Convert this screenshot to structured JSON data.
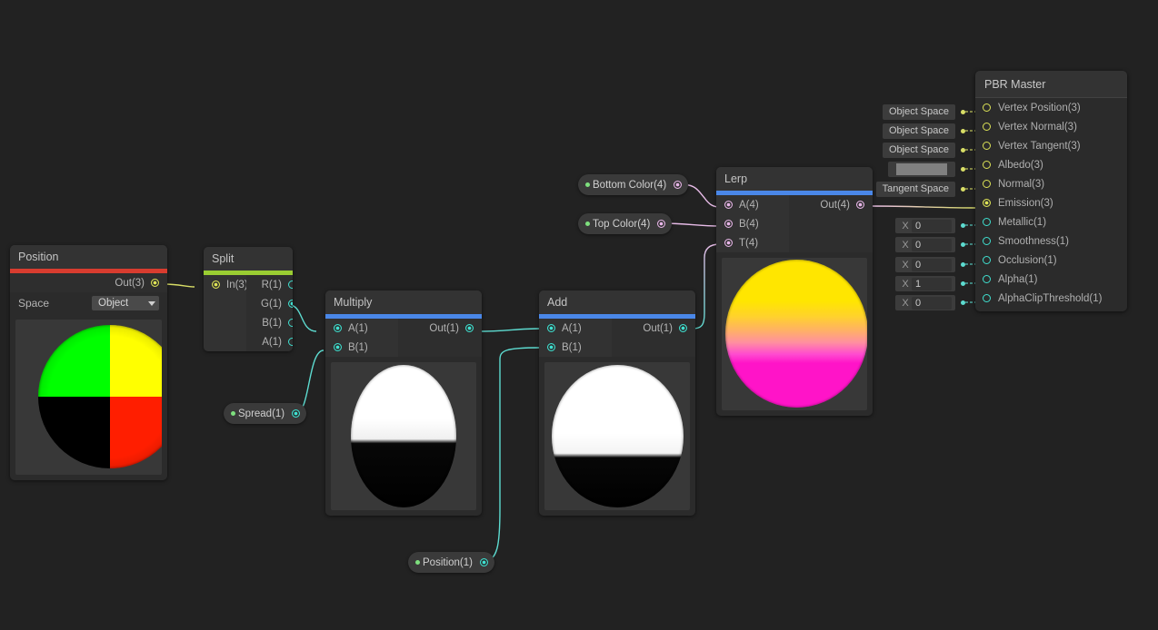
{
  "graph": {
    "background_color": "#222222",
    "node_color": "#2b2b2b",
    "accent_colors": {
      "position": "#d83c2f",
      "split": "#9acd32",
      "math": "#4a87e8"
    },
    "wire_colors": {
      "vector3": "#d8dd66",
      "float": "#5ddbd0",
      "vector4": "#e8bce8"
    }
  },
  "nodes": {
    "position": {
      "title": "Position",
      "accent": "#d83c2f",
      "outputs": [
        {
          "label": "Out(3)",
          "type": "vector3",
          "connected": true
        }
      ],
      "property": {
        "label": "Space",
        "value": "Object"
      },
      "preview": "position-object-space"
    },
    "split": {
      "title": "Split",
      "accent": "#9acd32",
      "inputs": [
        {
          "label": "In(3)",
          "type": "vector3",
          "connected": true
        }
      ],
      "outputs": [
        {
          "label": "R(1)",
          "type": "float",
          "connected": false
        },
        {
          "label": "G(1)",
          "type": "float",
          "connected": true
        },
        {
          "label": "B(1)",
          "type": "float",
          "connected": false
        },
        {
          "label": "A(1)",
          "type": "float",
          "connected": false
        }
      ]
    },
    "multiply": {
      "title": "Multiply",
      "accent": "#4a87e8",
      "inputs": [
        {
          "label": "A(1)",
          "type": "float",
          "connected": true
        },
        {
          "label": "B(1)",
          "type": "float",
          "connected": true
        }
      ],
      "outputs": [
        {
          "label": "Out(1)",
          "type": "float",
          "connected": true
        }
      ],
      "preview": "half-white-gradient"
    },
    "add": {
      "title": "Add",
      "accent": "#4a87e8",
      "inputs": [
        {
          "label": "A(1)",
          "type": "float",
          "connected": true
        },
        {
          "label": "B(1)",
          "type": "float",
          "connected": true
        }
      ],
      "outputs": [
        {
          "label": "Out(1)",
          "type": "float",
          "connected": true
        }
      ],
      "preview": "half-white-gradient-wide"
    },
    "lerp": {
      "title": "Lerp",
      "accent": "#4a87e8",
      "inputs": [
        {
          "label": "A(4)",
          "type": "vector4",
          "connected": true
        },
        {
          "label": "B(4)",
          "type": "vector4",
          "connected": true
        },
        {
          "label": "T(4)",
          "type": "vector4",
          "connected": true
        }
      ],
      "outputs": [
        {
          "label": "Out(4)",
          "type": "vector4",
          "connected": true
        }
      ],
      "preview": "yellow-magenta-gradient",
      "preview_colors": {
        "top": "#ffe600",
        "bottom": "#ff14c8"
      }
    }
  },
  "properties": [
    {
      "label": "Bottom Color(4)",
      "type": "vector4"
    },
    {
      "label": "Top Color(4)",
      "type": "vector4"
    },
    {
      "label": "Spread(1)",
      "type": "float"
    },
    {
      "label": "Position(1)",
      "type": "float"
    }
  ],
  "master": {
    "title": "PBR Master",
    "slots": [
      {
        "label": "Vertex Position(3)",
        "type": "vector3",
        "connected": false,
        "control": {
          "kind": "combo",
          "value": "Object Space"
        }
      },
      {
        "label": "Vertex Normal(3)",
        "type": "vector3",
        "connected": false,
        "control": {
          "kind": "combo",
          "value": "Object Space"
        }
      },
      {
        "label": "Vertex Tangent(3)",
        "type": "vector3",
        "connected": false,
        "control": {
          "kind": "combo",
          "value": "Object Space"
        }
      },
      {
        "label": "Albedo(3)",
        "type": "vector3",
        "connected": false,
        "control": {
          "kind": "swatch",
          "value": "#808080"
        }
      },
      {
        "label": "Normal(3)",
        "type": "vector3",
        "connected": false,
        "control": {
          "kind": "combo",
          "value": "Tangent Space"
        }
      },
      {
        "label": "Emission(3)",
        "type": "vector3",
        "connected": true,
        "control": {
          "kind": "none",
          "value": ""
        }
      },
      {
        "label": "Metallic(1)",
        "type": "float",
        "connected": false,
        "control": {
          "kind": "number",
          "axis": "X",
          "value": "0"
        }
      },
      {
        "label": "Smoothness(1)",
        "type": "float",
        "connected": false,
        "control": {
          "kind": "number",
          "axis": "X",
          "value": "0"
        }
      },
      {
        "label": "Occlusion(1)",
        "type": "float",
        "connected": false,
        "control": {
          "kind": "number",
          "axis": "X",
          "value": "0"
        }
      },
      {
        "label": "Alpha(1)",
        "type": "float",
        "connected": false,
        "control": {
          "kind": "number",
          "axis": "X",
          "value": "1"
        }
      },
      {
        "label": "AlphaClipThreshold(1)",
        "type": "float",
        "connected": false,
        "control": {
          "kind": "number",
          "axis": "X",
          "value": "0"
        }
      }
    ]
  }
}
